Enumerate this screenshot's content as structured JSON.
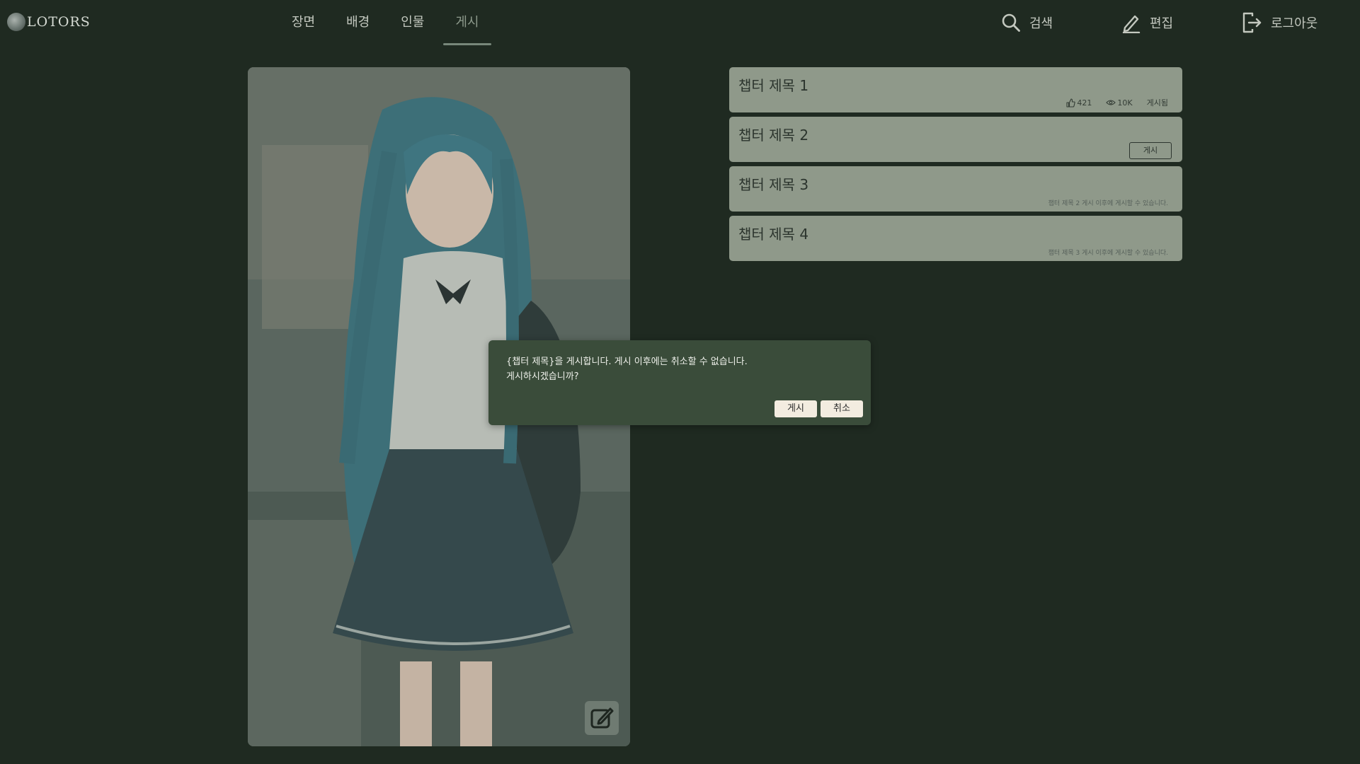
{
  "app": {
    "logo_text": "LOTORS"
  },
  "nav": {
    "tabs": [
      {
        "label": "장면",
        "active": false
      },
      {
        "label": "배경",
        "active": false
      },
      {
        "label": "인물",
        "active": false
      },
      {
        "label": "게시",
        "active": true
      }
    ]
  },
  "header_actions": {
    "search_label": "검색",
    "edit_label": "편집",
    "logout_label": "로그아웃"
  },
  "chapters": [
    {
      "title": "챕터 제목 1",
      "likes": "421",
      "views": "10K",
      "status": "게시됨"
    },
    {
      "title": "챕터 제목 2",
      "publish_button": "게시"
    },
    {
      "title": "챕터 제목 3",
      "note": "챕터 제목 2 게시 이후에 게시할 수 있습니다."
    },
    {
      "title": "챕터 제목 4",
      "note": "챕터 제목 3 게시 이후에 게시할 수 있습니다."
    }
  ],
  "dialog": {
    "line1": "{챕터 제목}을 게시합니다. 게시 이후에는 취소할 수 없습니다.",
    "line2": "게시하시겠습니까?",
    "confirm_label": "게시",
    "cancel_label": "취소"
  },
  "icons": {
    "search": "search-icon",
    "edit": "pencil-icon",
    "logout": "logout-icon",
    "like": "thumbs-up-icon",
    "views": "eye-icon",
    "image_edit": "edit-square-icon"
  },
  "colors": {
    "background": "#1f2a21",
    "chapter_card": "#8f998a",
    "dialog": "#3a4c3a",
    "dialog_button": "#f3ece0",
    "active_tab": "#8d9a8c"
  }
}
